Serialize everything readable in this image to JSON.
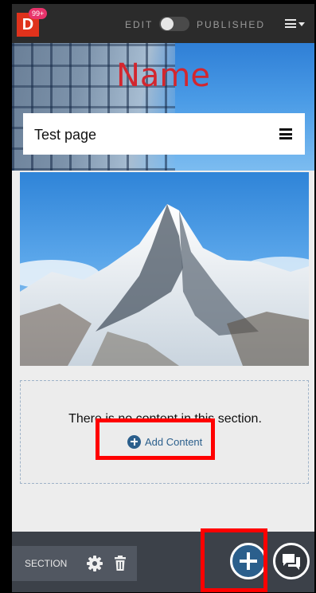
{
  "topbar": {
    "logo_letter": "D",
    "notifications": "99+",
    "edit_label": "EDIT",
    "published_label": "PUBLISHED",
    "toggle_state": "off"
  },
  "hero": {
    "title": "Name",
    "page_title": "Test page"
  },
  "empty_section": {
    "message": "There is no content in this section.",
    "add_label": "Add Content"
  },
  "bottom_toolbar": {
    "section_label": "SECTION"
  },
  "colors": {
    "accent_blue": "#2b5f8c",
    "logo_red": "#e0321c",
    "highlight_red": "#ff0000",
    "title_red": "#d3262e"
  },
  "icons": [
    "hamburger-menu-icon",
    "gear-icon",
    "trash-icon",
    "plus-icon",
    "chat-icon"
  ]
}
